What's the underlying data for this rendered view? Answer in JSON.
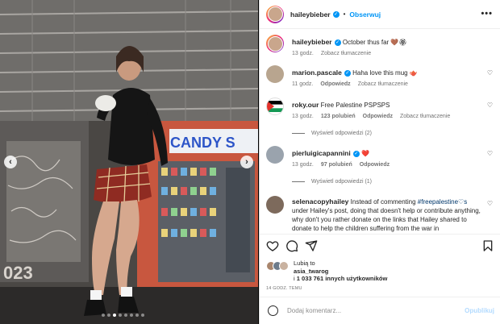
{
  "header": {
    "username": "haileybieber",
    "follow_label": "Obserwuj",
    "more_label": "•••"
  },
  "photo": {
    "store_sign": "CANDY S",
    "prev_label": "‹",
    "next_label": "›",
    "carousel_total": 8,
    "carousel_active": 2
  },
  "caption": {
    "username": "haileybieber",
    "text": "October thus far 🤎🏵",
    "age": "13 godz.",
    "translate": "Zobacz tłumaczenie"
  },
  "comments": [
    {
      "username": "marion.pascale",
      "verified": true,
      "text": "Haha love this mug 🫖",
      "age": "11 godz.",
      "reply": "Odpowiedz",
      "translate": "Zobacz tłumaczenie",
      "likes": ""
    },
    {
      "username": "roky.our",
      "verified": false,
      "text": "Free Palestine PSPSPS",
      "age": "13 godz.",
      "likes": "123 polubień",
      "reply": "Odpowiedz",
      "translate": "Zobacz tłumaczenie",
      "view_replies": "Wyświetl odpowiedzi (2)"
    },
    {
      "username": "pierluigicapannini",
      "verified": true,
      "text": "❤️",
      "age": "13 godz.",
      "likes": "97 polubień",
      "reply": "Odpowiedz",
      "view_replies": "Wyświetl odpowiedzi (1)"
    },
    {
      "username": "selenacopyhailey",
      "verified": false,
      "text_before": "Instead of commenting ",
      "hashtag": "#freepalestine♡s",
      "text_after": " under Hailey's post, doing that doesn't help or contribute anything, why don't you rather donate on the links that Hailey shared to donate to help the children suffering from the war in"
    }
  ],
  "likes": {
    "prefix": "Lubią to",
    "user": "asia_twarog",
    "connector": "i",
    "count": "1 033 761 innych użytkowników"
  },
  "time": "14 GODZ. TEMU",
  "add_comment": {
    "placeholder": "Dodaj komentarz...",
    "post_label": "Opublikuj"
  },
  "colors": {
    "accent": "#0095f6",
    "post_disabled": "#b3dbff",
    "hashtag": "#00376b",
    "heart_red": "#ed4956"
  }
}
